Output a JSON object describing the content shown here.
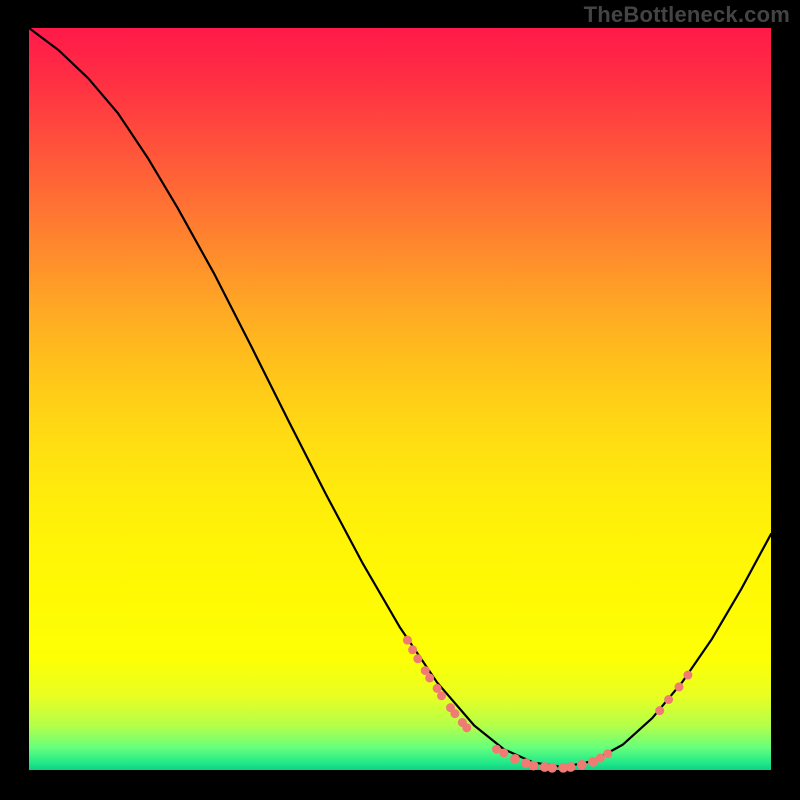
{
  "watermark": "TheBottleneck.com",
  "chart_data": {
    "type": "line",
    "title": "",
    "xlabel": "",
    "ylabel": "",
    "xlim": [
      0,
      100
    ],
    "ylim": [
      0,
      100
    ],
    "curve": {
      "name": "bottleneck-curve",
      "points": [
        {
          "x": 0.0,
          "y": 100.0
        },
        {
          "x": 4.0,
          "y": 97.0
        },
        {
          "x": 8.0,
          "y": 93.2
        },
        {
          "x": 12.0,
          "y": 88.5
        },
        {
          "x": 16.0,
          "y": 82.5
        },
        {
          "x": 20.0,
          "y": 75.8
        },
        {
          "x": 25.0,
          "y": 66.8
        },
        {
          "x": 30.0,
          "y": 57.0
        },
        {
          "x": 35.0,
          "y": 47.0
        },
        {
          "x": 40.0,
          "y": 37.2
        },
        {
          "x": 45.0,
          "y": 27.8
        },
        {
          "x": 50.0,
          "y": 19.2
        },
        {
          "x": 55.0,
          "y": 11.8
        },
        {
          "x": 60.0,
          "y": 6.0
        },
        {
          "x": 64.0,
          "y": 2.8
        },
        {
          "x": 68.0,
          "y": 1.0
        },
        {
          "x": 72.0,
          "y": 0.4
        },
        {
          "x": 76.0,
          "y": 1.2
        },
        {
          "x": 80.0,
          "y": 3.4
        },
        {
          "x": 84.0,
          "y": 7.0
        },
        {
          "x": 88.0,
          "y": 11.8
        },
        {
          "x": 92.0,
          "y": 17.6
        },
        {
          "x": 96.0,
          "y": 24.4
        },
        {
          "x": 100.0,
          "y": 31.8
        }
      ]
    },
    "markers": [
      {
        "x": 51.0,
        "y": 17.5,
        "r": 1.1
      },
      {
        "x": 51.7,
        "y": 16.2,
        "r": 1.1
      },
      {
        "x": 52.4,
        "y": 15.0,
        "r": 1.1
      },
      {
        "x": 53.4,
        "y": 13.4,
        "r": 1.1
      },
      {
        "x": 54.0,
        "y": 12.4,
        "r": 1.1
      },
      {
        "x": 55.0,
        "y": 11.0,
        "r": 1.1
      },
      {
        "x": 55.6,
        "y": 10.0,
        "r": 1.1
      },
      {
        "x": 56.8,
        "y": 8.4,
        "r": 1.1
      },
      {
        "x": 57.4,
        "y": 7.6,
        "r": 1.1
      },
      {
        "x": 58.4,
        "y": 6.4,
        "r": 1.1
      },
      {
        "x": 59.0,
        "y": 5.7,
        "r": 1.1
      },
      {
        "x": 63.0,
        "y": 2.8,
        "r": 1.1
      },
      {
        "x": 64.0,
        "y": 2.3,
        "r": 1.1
      },
      {
        "x": 65.5,
        "y": 1.5,
        "r": 1.2
      },
      {
        "x": 67.0,
        "y": 0.9,
        "r": 1.2
      },
      {
        "x": 68.0,
        "y": 0.6,
        "r": 1.2
      },
      {
        "x": 69.5,
        "y": 0.4,
        "r": 1.2
      },
      {
        "x": 70.5,
        "y": 0.3,
        "r": 1.2
      },
      {
        "x": 72.0,
        "y": 0.3,
        "r": 1.2
      },
      {
        "x": 73.0,
        "y": 0.4,
        "r": 1.2
      },
      {
        "x": 74.5,
        "y": 0.7,
        "r": 1.2
      },
      {
        "x": 76.0,
        "y": 1.1,
        "r": 1.2
      },
      {
        "x": 77.0,
        "y": 1.6,
        "r": 1.1
      },
      {
        "x": 78.0,
        "y": 2.2,
        "r": 1.1
      },
      {
        "x": 85.0,
        "y": 8.0,
        "r": 1.1
      },
      {
        "x": 86.2,
        "y": 9.5,
        "r": 1.1
      },
      {
        "x": 87.6,
        "y": 11.2,
        "r": 1.1
      },
      {
        "x": 88.8,
        "y": 12.8,
        "r": 1.1
      }
    ],
    "background_gradient": {
      "top": "#ff1a49",
      "mid": "#ffe400",
      "accent": "#22e98a",
      "bottom": "#10d184"
    }
  }
}
